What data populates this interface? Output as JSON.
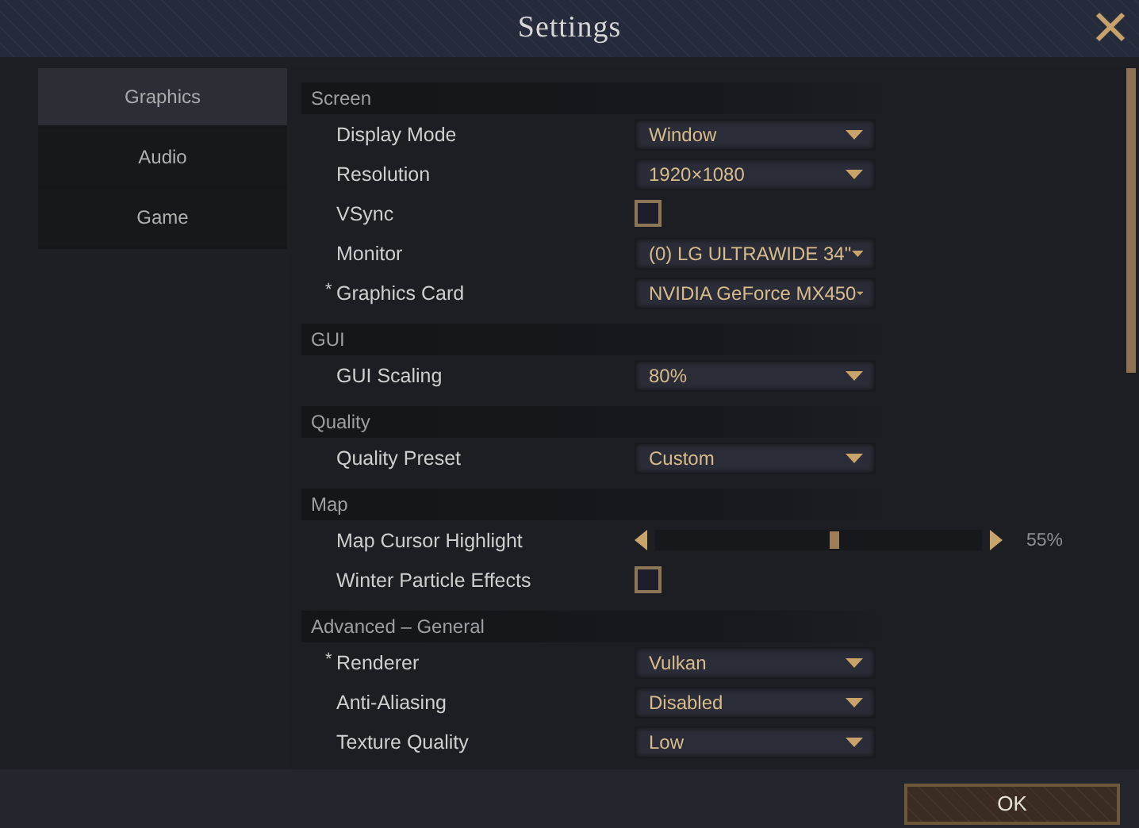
{
  "window": {
    "title": "Settings"
  },
  "tabs": [
    {
      "label": "Graphics",
      "selected": true
    },
    {
      "label": "Audio",
      "selected": false
    },
    {
      "label": "Game",
      "selected": false
    }
  ],
  "sections": [
    {
      "title": "Screen",
      "rows": [
        {
          "kind": "dropdown",
          "label": "Display Mode",
          "value": "Window"
        },
        {
          "kind": "dropdown",
          "label": "Resolution",
          "value": "1920×1080"
        },
        {
          "kind": "checkbox",
          "label": "VSync",
          "checked": false
        },
        {
          "kind": "dropdown",
          "label": "Monitor",
          "value": "(0) LG ULTRAWIDE 34\""
        },
        {
          "kind": "dropdown",
          "label": "Graphics Card",
          "marker": "*",
          "value": "NVIDIA GeForce MX450"
        }
      ]
    },
    {
      "title": "GUI",
      "rows": [
        {
          "kind": "dropdown",
          "label": "GUI Scaling",
          "value": "80%"
        }
      ]
    },
    {
      "title": "Quality",
      "rows": [
        {
          "kind": "dropdown",
          "label": "Quality Preset",
          "value": "Custom"
        }
      ]
    },
    {
      "title": "Map",
      "rows": [
        {
          "kind": "slider",
          "label": "Map Cursor Highlight",
          "level": 0.55,
          "reading": "55%"
        },
        {
          "kind": "checkbox",
          "label": "Winter Particle Effects",
          "checked": false
        }
      ]
    },
    {
      "title": "Advanced – General",
      "rows": [
        {
          "kind": "dropdown",
          "label": "Renderer",
          "marker": "*",
          "value": "Vulkan"
        },
        {
          "kind": "dropdown",
          "label": "Anti-Aliasing",
          "value": "Disabled"
        },
        {
          "kind": "dropdown",
          "label": "Texture Quality",
          "value": "Low"
        }
      ]
    }
  ],
  "ok_button": {
    "label": "OK"
  }
}
